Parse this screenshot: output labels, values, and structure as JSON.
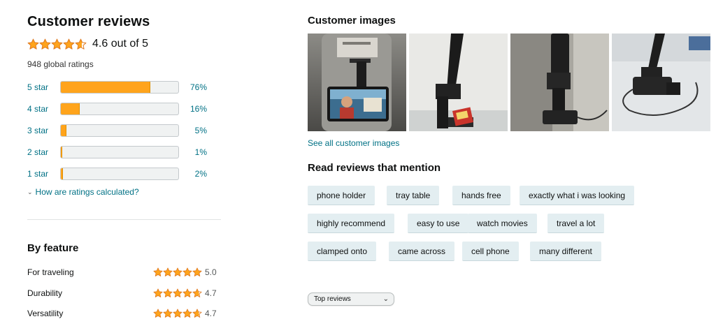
{
  "reviews": {
    "title": "Customer reviews",
    "average_stars": 4.6,
    "average_text": "4.6 out of 5",
    "global_ratings": "948 global ratings",
    "histogram": [
      {
        "label": "5 star",
        "pct_text": "76%",
        "pct": 76
      },
      {
        "label": "4 star",
        "pct_text": "16%",
        "pct": 16
      },
      {
        "label": "3 star",
        "pct_text": "5%",
        "pct": 5
      },
      {
        "label": "2 star",
        "pct_text": "1%",
        "pct": 1
      },
      {
        "label": "1 star",
        "pct_text": "2%",
        "pct": 2
      }
    ],
    "calc_link": "How are ratings calculated?"
  },
  "features": {
    "title": "By feature",
    "items": [
      {
        "name": "For traveling",
        "value": "5.0",
        "stars": 5.0
      },
      {
        "name": "Durability",
        "value": "4.7",
        "stars": 4.7
      },
      {
        "name": "Versatility",
        "value": "4.7",
        "stars": 4.7
      }
    ]
  },
  "images": {
    "title": "Customer images",
    "see_all": "See all customer images",
    "thumbnails": [
      "airplane-seat-phone-holder",
      "black-stand-close-up",
      "holder-on-seatback",
      "stand-with-cable"
    ]
  },
  "mentions": {
    "title": "Read reviews that mention",
    "chips": [
      "phone holder",
      "tray table",
      "hands free",
      "exactly what i was looking",
      "highly recommend",
      "easy to use",
      "watch movies",
      "travel a lot",
      "clamped onto",
      "came across",
      "cell phone",
      "many different"
    ]
  },
  "sort": {
    "selected": "Top reviews"
  },
  "colors": {
    "star": "#ffa41c",
    "link": "#007185",
    "chip_bg": "#e3eef1"
  }
}
